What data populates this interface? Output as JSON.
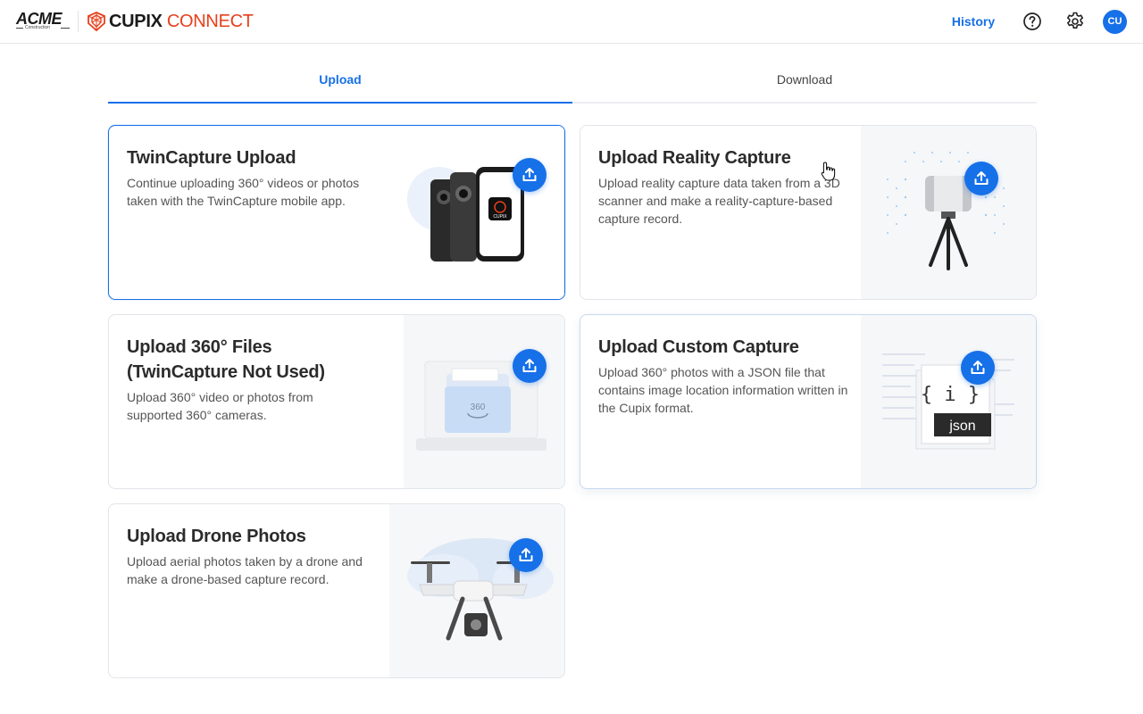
{
  "header": {
    "acme_logo": "ACME",
    "acme_sub": "Construction",
    "brand_bold": "CUPIX",
    "brand_light": "CONNECT",
    "history_label": "History",
    "avatar_initials": "CU",
    "brand_color": "#e8401c",
    "accent_color": "#1670e8"
  },
  "tabs": [
    {
      "label": "Upload",
      "active": true
    },
    {
      "label": "Download",
      "active": false
    }
  ],
  "cards": [
    {
      "title": "TwinCapture Upload",
      "description": "Continue uploading 360° videos or photos taken with the TwinCapture mobile app.",
      "art_label": "CUPIX",
      "icon": "upload-icon"
    },
    {
      "title": "Upload Reality Capture",
      "description": "Upload reality capture data taken from a 3D scanner and make a reality-capture-based capture record.",
      "icon": "upload-icon"
    },
    {
      "title": "Upload 360° Files (TwinCapture Not Used)",
      "description": "Upload 360° video or photos from supported 360° cameras.",
      "art_label": "360",
      "icon": "upload-icon"
    },
    {
      "title": "Upload Custom Capture",
      "description": "Upload 360° photos with a JSON file that contains image location information written in the Cupix format.",
      "art_label": "{ i }",
      "art_label2": "json",
      "icon": "upload-icon"
    },
    {
      "title": "Upload Drone Photos",
      "description": "Upload aerial photos taken by a drone and make a drone-based capture record.",
      "icon": "upload-icon"
    }
  ]
}
